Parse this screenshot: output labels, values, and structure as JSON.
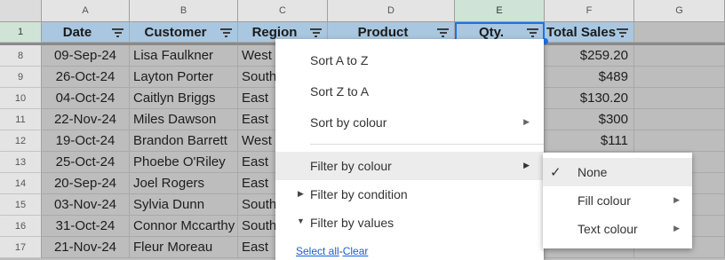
{
  "columns": [
    "A",
    "B",
    "C",
    "D",
    "E",
    "F",
    "G"
  ],
  "header_row_number": "1",
  "headers": [
    "Date",
    "Customer",
    "Region",
    "Product",
    "Qty.",
    "Total Sales"
  ],
  "rows": [
    {
      "num": "8",
      "date": "09-Sep-24",
      "customer": "Lisa Faulkner",
      "region": "West",
      "total": "$259.20"
    },
    {
      "num": "9",
      "date": "26-Oct-24",
      "customer": "Layton Porter",
      "region": "South",
      "total": "$489"
    },
    {
      "num": "10",
      "date": "04-Oct-24",
      "customer": "Caitlyn Briggs",
      "region": "East",
      "total": "$130.20"
    },
    {
      "num": "11",
      "date": "22-Nov-24",
      "customer": "Miles Dawson",
      "region": "East",
      "total": "$300"
    },
    {
      "num": "12",
      "date": "19-Oct-24",
      "customer": "Brandon Barrett",
      "region": "West",
      "total": "$111"
    },
    {
      "num": "13",
      "date": "25-Oct-24",
      "customer": "Phoebe O'Riley",
      "region": "East",
      "total": ""
    },
    {
      "num": "14",
      "date": "20-Sep-24",
      "customer": "Joel Rogers",
      "region": "East",
      "total": ""
    },
    {
      "num": "15",
      "date": "03-Nov-24",
      "customer": "Sylvia Dunn",
      "region": "South",
      "total": ""
    },
    {
      "num": "16",
      "date": "31-Oct-24",
      "customer": "Connor Mccarthy",
      "region": "South",
      "total": ""
    },
    {
      "num": "17",
      "date": "21-Nov-24",
      "customer": "Fleur Moreau",
      "region": "East",
      "total": ""
    }
  ],
  "menu": {
    "sort_az": "Sort A to Z",
    "sort_za": "Sort Z to A",
    "sort_colour": "Sort by colour",
    "filter_colour": "Filter by colour",
    "filter_condition": "Filter by condition",
    "filter_values": "Filter by values",
    "select_all": "Select all",
    "separator": "-",
    "clear": "Clear"
  },
  "submenu": {
    "none": "None",
    "fill_colour": "Fill colour",
    "text_colour": "Text colour"
  },
  "colors": {
    "header_fill": "#a9c7e0",
    "selection_blue": "#1a73e8",
    "dimmed_sheet": "#bdbdbd",
    "link": "#1a5fd1"
  }
}
